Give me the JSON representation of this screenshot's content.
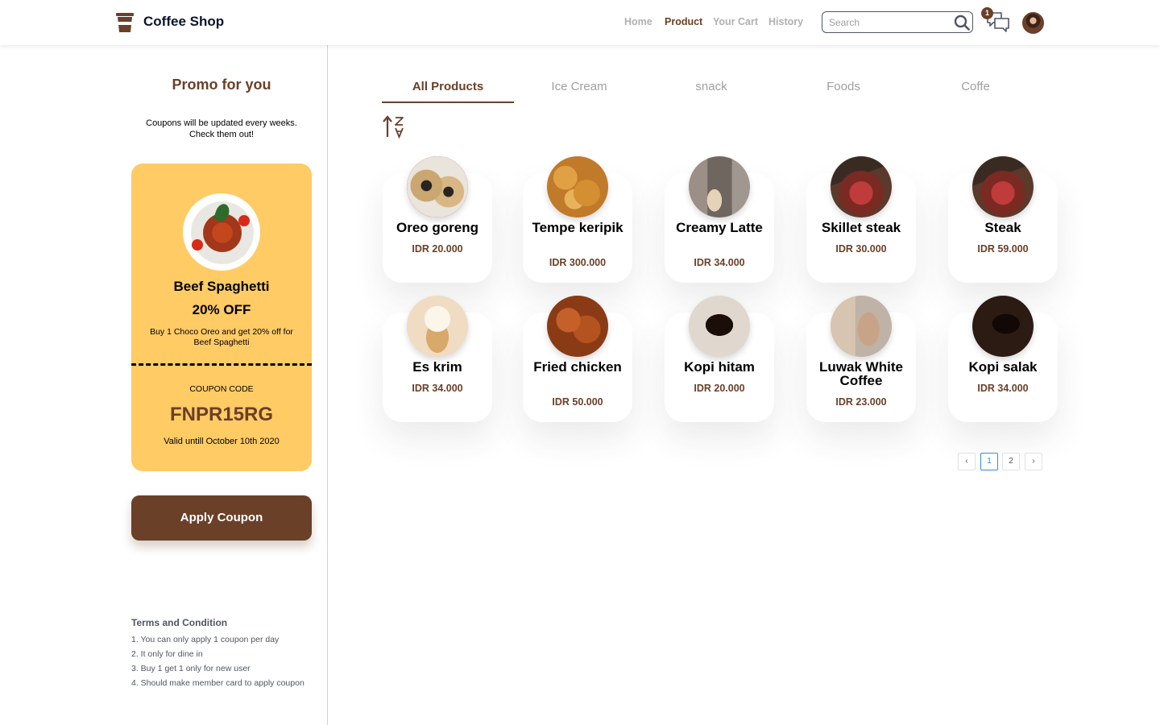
{
  "header": {
    "brand": "Coffee Shop",
    "nav": [
      {
        "label": "Home",
        "active": false
      },
      {
        "label": "Product",
        "active": true
      },
      {
        "label": "Your Cart",
        "active": false
      },
      {
        "label": "History",
        "active": false
      }
    ],
    "search_placeholder": "Search",
    "chat_badge": "1"
  },
  "sidebar": {
    "title": "Promo for you",
    "subtitle_line1": "Coupons will be updated every weeks.",
    "subtitle_line2": "Check them out!",
    "coupon": {
      "name": "Beef Spaghetti",
      "discount": "20% OFF",
      "description": "Buy 1 Choco Oreo and get 20% off for Beef Spaghetti",
      "code_label": "COUPON CODE",
      "code": "FNPR15RG",
      "valid": "Valid untill October 10th 2020"
    },
    "apply_label": "Apply Coupon",
    "terms_title": "Terms and Condition",
    "terms": [
      "1. You can only apply 1 coupon per day",
      "2. It only for dine in",
      "3. Buy 1 get 1 only for new user",
      "4. Should make member card to apply coupon"
    ]
  },
  "tabs": [
    {
      "label": "All Products",
      "active": true
    },
    {
      "label": "Ice Cream",
      "active": false
    },
    {
      "label": "snack",
      "active": false
    },
    {
      "label": "Foods",
      "active": false
    },
    {
      "label": "Coffe",
      "active": false
    }
  ],
  "products": [
    {
      "name": "Oreo goreng",
      "price": "IDR 20.000",
      "image": "oreo-goreng-photo"
    },
    {
      "name": "Tempe keripik",
      "price": "IDR 300.000",
      "image": "tempe-keripik-photo"
    },
    {
      "name": "Creamy Latte",
      "price": "IDR 34.000",
      "image": "creamy-latte-photo"
    },
    {
      "name": "Skillet steak",
      "price": "IDR 30.000",
      "image": "skillet-steak-photo"
    },
    {
      "name": "Steak",
      "price": "IDR 59.000",
      "image": "steak-photo"
    },
    {
      "name": "Es krim",
      "price": "IDR 34.000",
      "image": "es-krim-photo"
    },
    {
      "name": "Fried chicken",
      "price": "IDR 50.000",
      "image": "fried-chicken-photo"
    },
    {
      "name": "Kopi hitam",
      "price": "IDR 20.000",
      "image": "kopi-hitam-photo"
    },
    {
      "name": "Luwak White Coffee",
      "price": "IDR 23.000",
      "image": "luwak-white-coffee-photo"
    },
    {
      "name": "Kopi salak",
      "price": "IDR 34.000",
      "image": "kopi-salak-photo"
    }
  ],
  "pagination": {
    "prev": "‹",
    "pages": [
      "1",
      "2"
    ],
    "current": "1",
    "next": "›"
  },
  "colors": {
    "brand_brown": "#6a4029",
    "coupon_yellow": "#ffcb65",
    "page_active": "#2d8ee5"
  }
}
